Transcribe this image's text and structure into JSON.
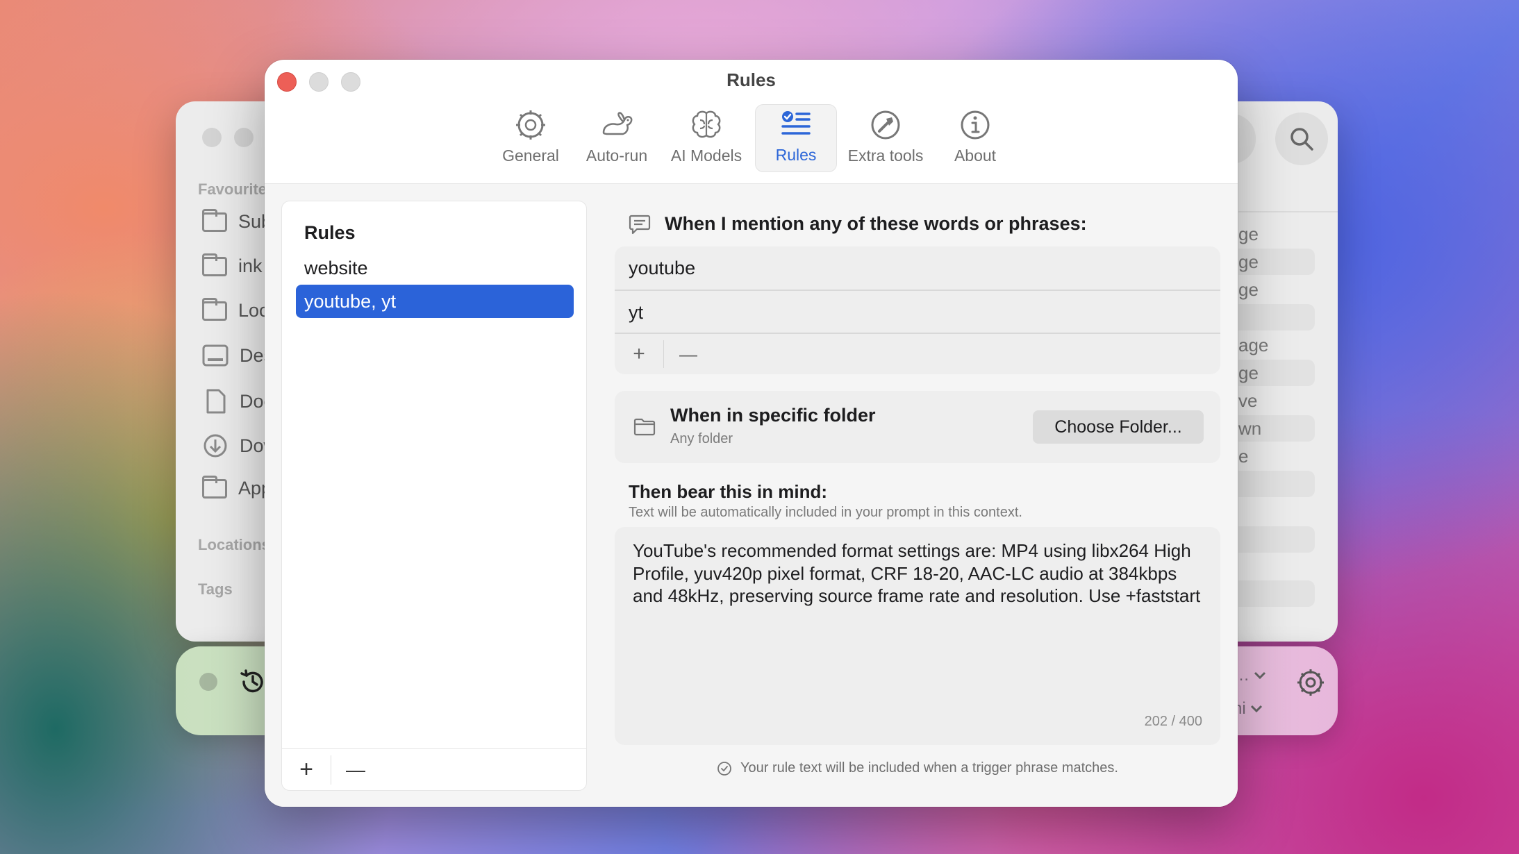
{
  "background_window": {
    "sidebar_sections": [
      "Favourites",
      "Locations",
      "Tags"
    ],
    "sidebar_items": [
      "Sub",
      "ink",
      "Loc",
      "Des",
      "Doc",
      "Dow",
      "App"
    ],
    "right_list": [
      "ge",
      "ge",
      "ge",
      "age",
      "ge",
      "ve",
      "wn",
      "e"
    ]
  },
  "bottom_bar": {
    "right_top": "…",
    "right_bottom": "ni"
  },
  "window": {
    "title": "Rules",
    "tabs": [
      {
        "label": "General",
        "icon": "gear-icon"
      },
      {
        "label": "Auto-run",
        "icon": "rabbit-icon"
      },
      {
        "label": "AI Models",
        "icon": "brain-icon"
      },
      {
        "label": "Rules",
        "icon": "checklist-icon",
        "active": true
      },
      {
        "label": "Extra tools",
        "icon": "hammer-icon"
      },
      {
        "label": "About",
        "icon": "info-icon"
      }
    ]
  },
  "rules_panel": {
    "heading": "Rules",
    "items": [
      "website",
      "youtube, yt"
    ],
    "selected_index": 1,
    "add_label": "+",
    "remove_label": "—"
  },
  "trigger": {
    "title": "When I mention any of these words or phrases:",
    "phrases": [
      "youtube",
      "yt"
    ],
    "add_label": "+",
    "remove_label": "—"
  },
  "folder": {
    "title": "When in specific folder",
    "subtitle": "Any folder",
    "button_label": "Choose Folder..."
  },
  "mind": {
    "title": "Then bear this in mind:",
    "subtitle": "Text will be automatically included in your prompt in this context.",
    "text": "YouTube's recommended format settings are: MP4 using libx264 High Profile, yuv420p pixel format, CRF 18-20, AAC-LC audio at 384kbps and 48kHz, preserving source frame rate and resolution. Use +faststart",
    "char_count": "202 / 400"
  },
  "footer_note": "Your rule text will be included when a trigger phrase matches.",
  "colors": {
    "accent": "#2b63d9",
    "close": "#ed5f57"
  }
}
